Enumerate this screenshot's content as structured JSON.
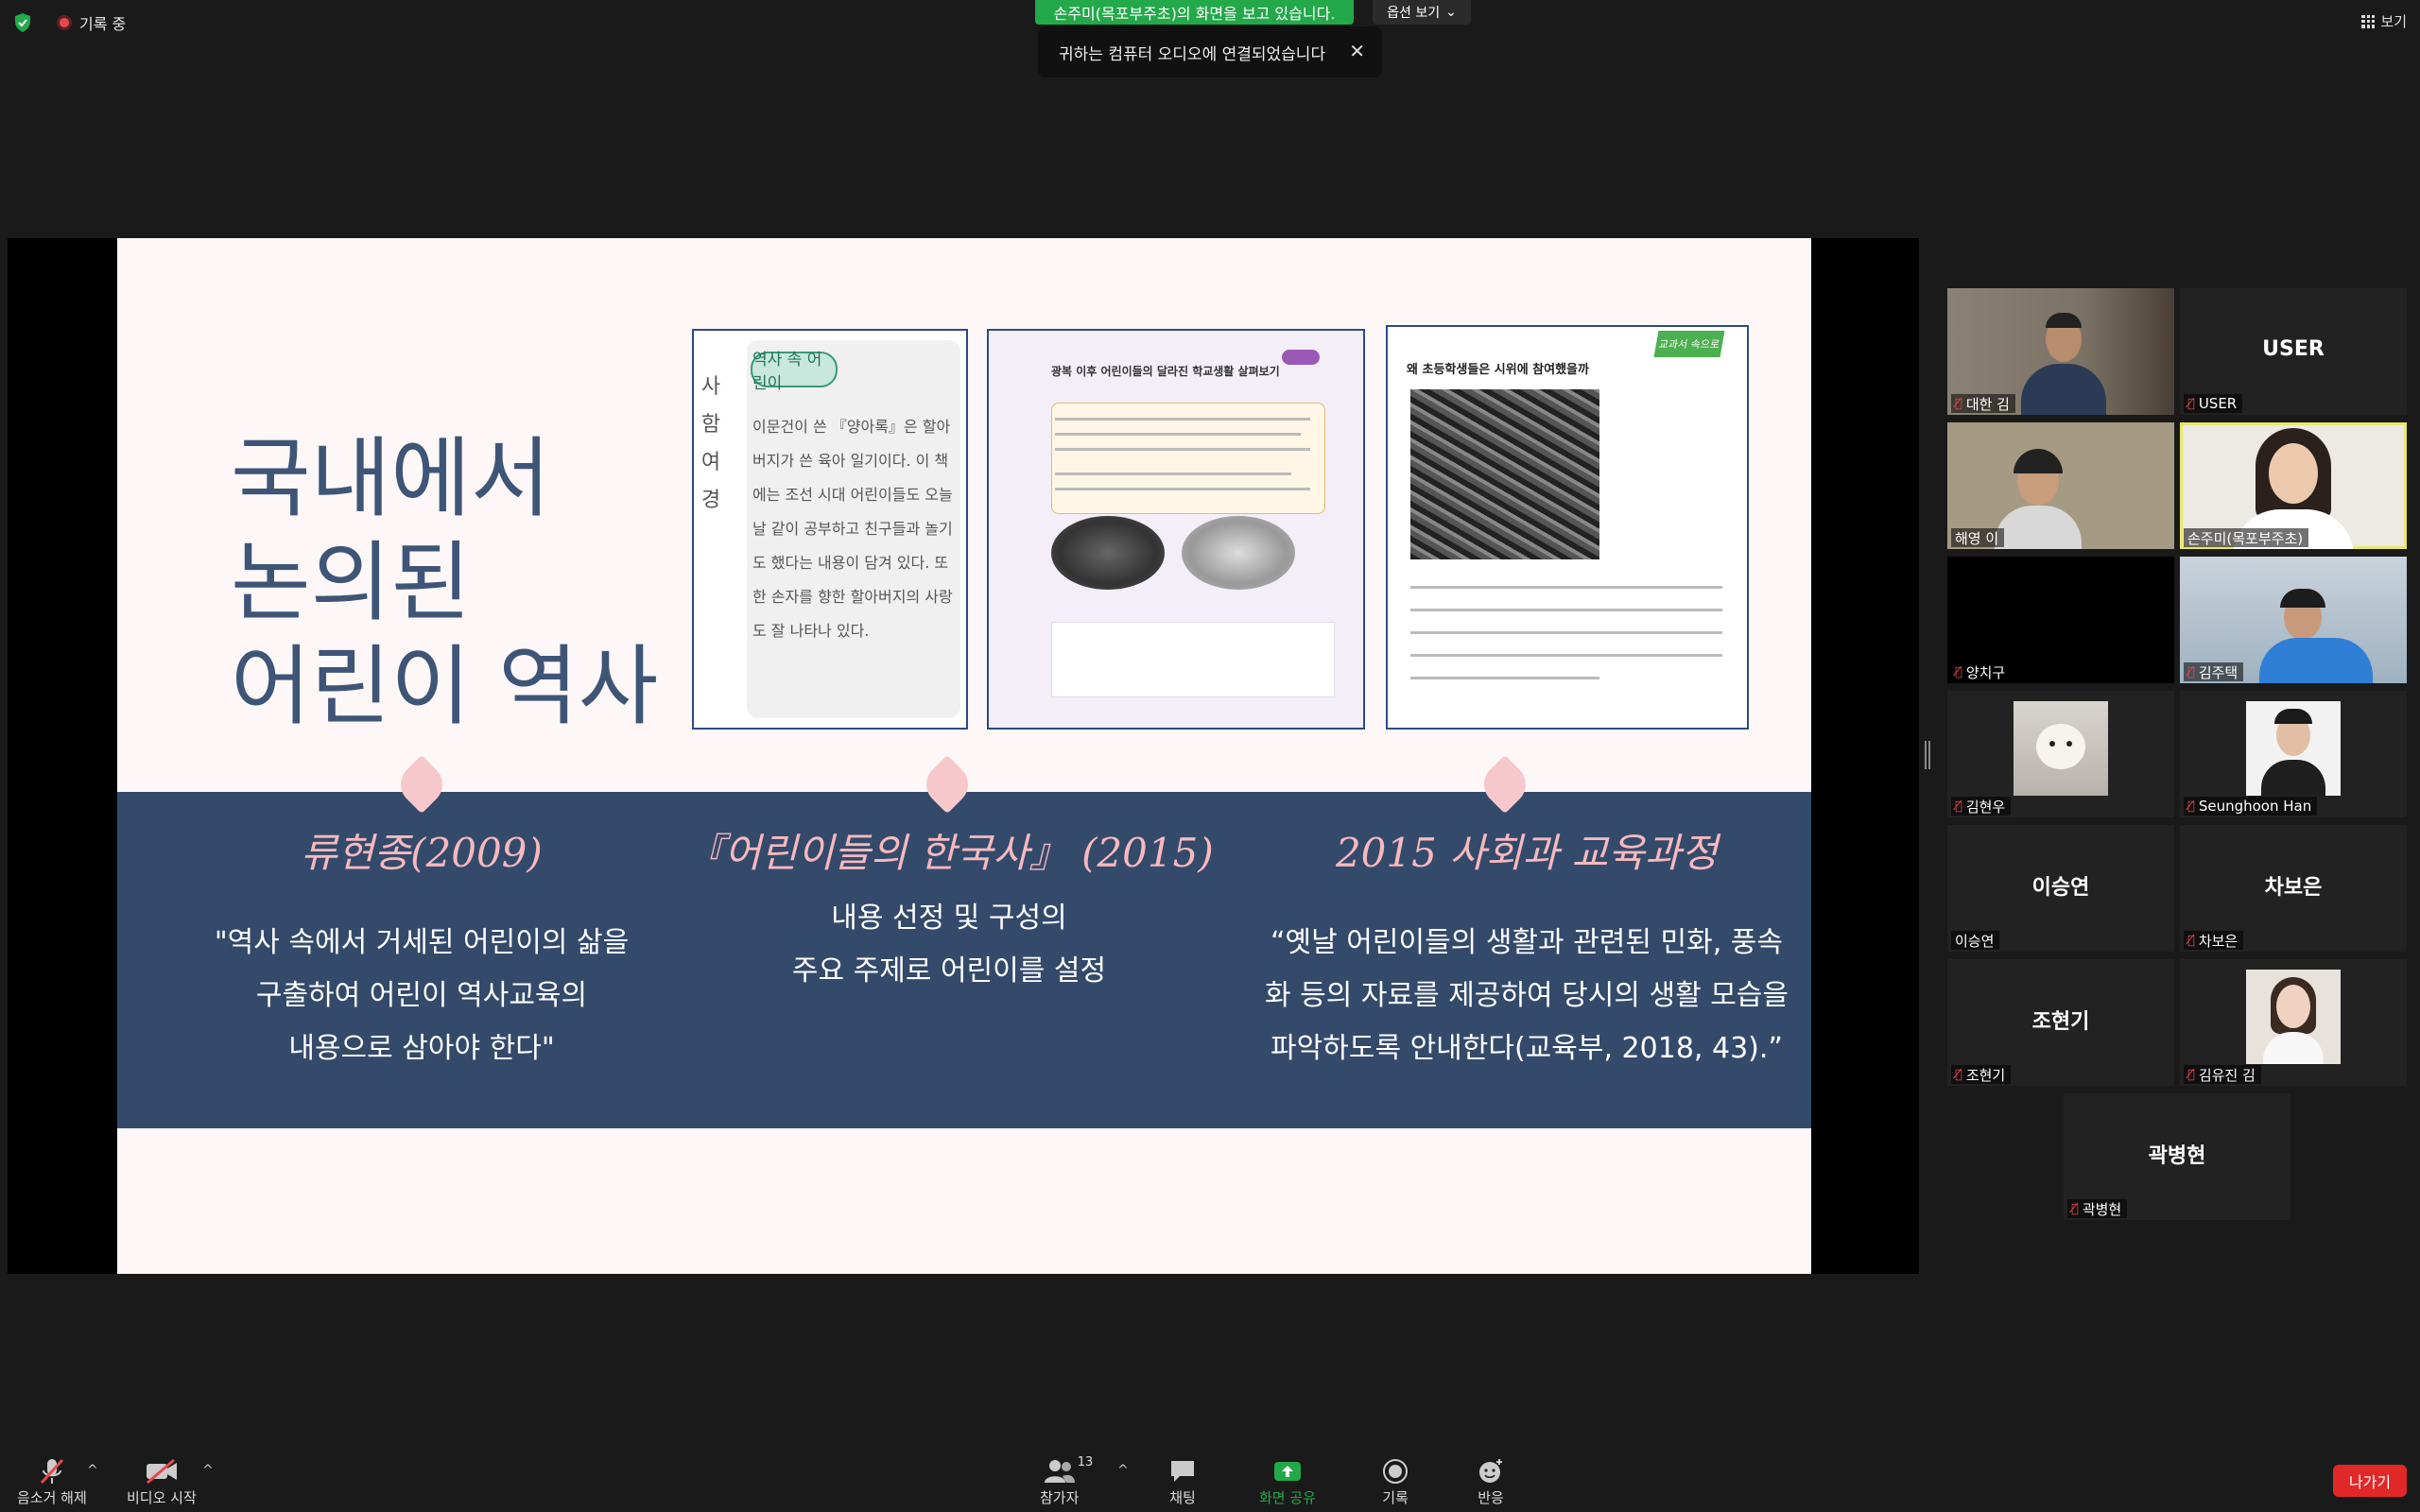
{
  "topbar": {
    "recording_label": "기록 중",
    "share_banner": "손주미(목포부주초)의 화면을 보고 있습니다.",
    "view_options_label": "옵션 보기",
    "audio_toast": "귀하는 컴퓨터 오디오에 연결되었습니다",
    "view_label": "보기"
  },
  "slide": {
    "title_lines": [
      "국내에서",
      "논의된",
      "어린이 역사"
    ],
    "book1": {
      "vertical_text": [
        "사",
        "함",
        "여",
        "경"
      ],
      "tag": "역사 속 어린이",
      "text": "이문건이 쓴 『양아록』은 할아버지가 쓴 육아 일기이다. 이 책에는 조선 시대 어린이들도 오늘날 같이 공부하고 친구들과 놀기도 했다는 내용이 담겨 있다. 또한 손자를 향한 할아버지의 사랑도 잘 나타나 있다."
    },
    "book2": {
      "title": "광복 이후 어린이들의 달라진 학교생활 살펴보기"
    },
    "book3": {
      "tag": "교과서 속으로",
      "title": "왜 초등학생들은 시위에 참여했을까"
    },
    "columns": [
      {
        "head": "류현종(2009)",
        "body": [
          "\"역사 속에서 거세된 어린이의 삶을",
          "구출하여 어린이 역사교육의",
          "내용으로 삼아야 한다\""
        ]
      },
      {
        "head": "『어린이들의 한국사』 (2015)",
        "body": [
          "내용 선정 및 구성의",
          "주요 주제로 어린이를 설정"
        ]
      },
      {
        "head": "2015 사회과 교육과정",
        "body": [
          "“옛날 어린이들의 생활과 관련된 민화, 풍속",
          "화 등의 자료를 제공하여 당시의 생활 모습을",
          "파악하도록 안내한다(교육부, 2018, 43).”"
        ]
      }
    ]
  },
  "participants": [
    {
      "name": "대한 김",
      "display": "",
      "type": "camera"
    },
    {
      "name": "USER",
      "display": "USER",
      "type": "text"
    },
    {
      "name": "해영 이",
      "display": "",
      "type": "camera"
    },
    {
      "name": "손주미(목포부주초)",
      "display": "",
      "type": "camera",
      "active": true
    },
    {
      "name": "양치구",
      "display": "",
      "type": "black"
    },
    {
      "name": "김주택",
      "display": "",
      "type": "camera"
    },
    {
      "name": "김현우",
      "display": "",
      "type": "thumb"
    },
    {
      "name": "Seunghoon Han",
      "display": "",
      "type": "thumb"
    },
    {
      "name": "이승연",
      "display": "이승연",
      "type": "text"
    },
    {
      "name": "차보은",
      "display": "차보은",
      "type": "text"
    },
    {
      "name": "조현기",
      "display": "조현기",
      "type": "text"
    },
    {
      "name": "김유진 김",
      "display": "",
      "type": "thumb"
    },
    {
      "name": "곽병현",
      "display": "곽병현",
      "type": "text"
    }
  ],
  "toolbar": {
    "unmute": "음소거 해제",
    "start_video": "비디오 시작",
    "participants": "참가자",
    "participants_count": "13",
    "chat": "채팅",
    "share_screen": "화면 공유",
    "record": "기록",
    "reactions": "반응",
    "leave": "나가기"
  },
  "colors": {
    "share_green": "#23a84a",
    "slide_band": "#344a6b",
    "slide_title": "#3f5577",
    "accent_pink": "#f6b9bf",
    "leave_red": "#e02828",
    "active_speaker": "#e8e96b"
  }
}
